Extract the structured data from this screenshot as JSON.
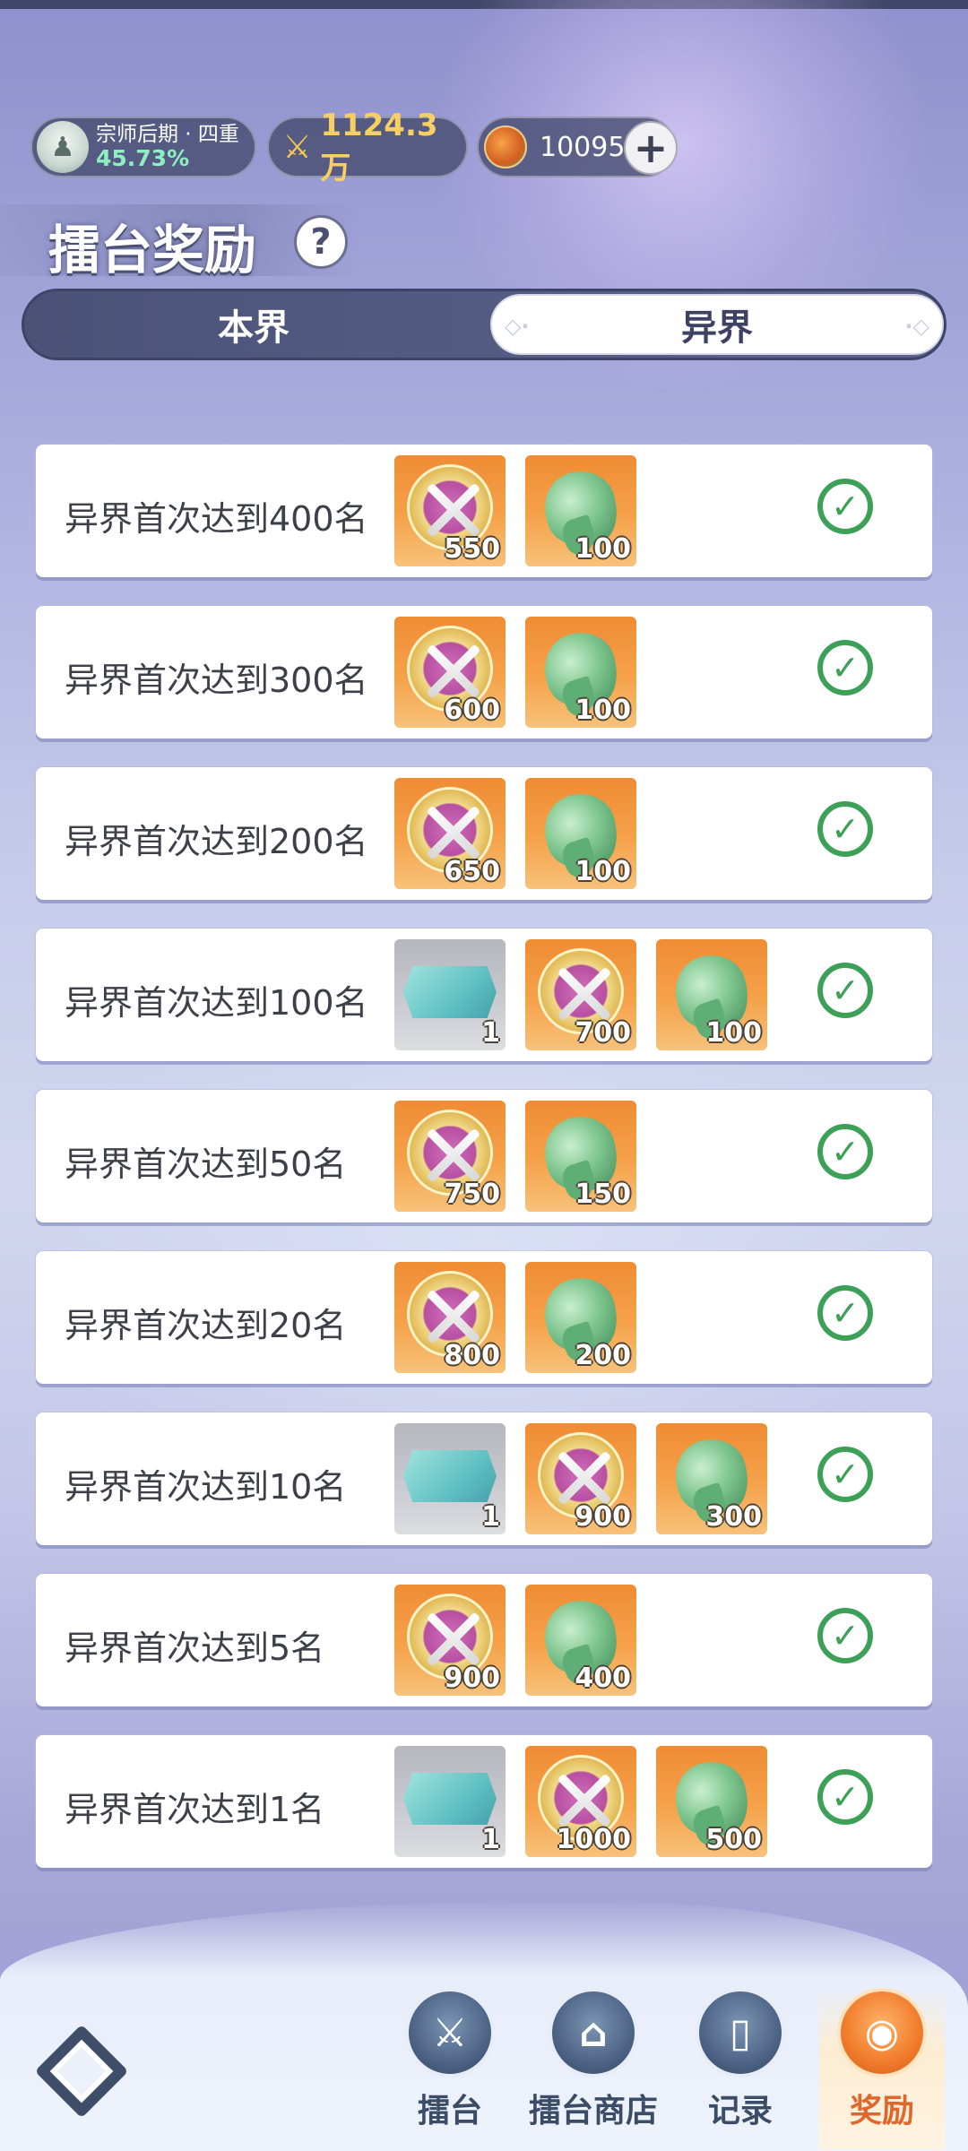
{
  "status": {
    "realm_name": "宗师后期 · 四重",
    "realm_progress": "45.73%",
    "power": "1124.3万",
    "currency": "10095"
  },
  "header": {
    "title": "擂台奖励",
    "help": "?"
  },
  "tabs": [
    {
      "label": "本界",
      "selected": false
    },
    {
      "label": "异界",
      "selected": true
    }
  ],
  "rows": [
    {
      "label": "异界首次达到400名",
      "rewards": [
        {
          "item": "medal-icon",
          "qty": "550"
        },
        {
          "item": "jade-icon",
          "qty": "100"
        }
      ],
      "claimed": true
    },
    {
      "label": "异界首次达到300名",
      "rewards": [
        {
          "item": "medal-icon",
          "qty": "600"
        },
        {
          "item": "jade-icon",
          "qty": "100"
        }
      ],
      "claimed": true
    },
    {
      "label": "异界首次达到200名",
      "rewards": [
        {
          "item": "medal-icon",
          "qty": "650"
        },
        {
          "item": "jade-icon",
          "qty": "100"
        }
      ],
      "claimed": true
    },
    {
      "label": "异界首次达到100名",
      "rewards": [
        {
          "item": "ticket-icon",
          "qty": "1"
        },
        {
          "item": "medal-icon",
          "qty": "700"
        },
        {
          "item": "jade-icon",
          "qty": "100"
        }
      ],
      "claimed": true
    },
    {
      "label": "异界首次达到50名",
      "rewards": [
        {
          "item": "medal-icon",
          "qty": "750"
        },
        {
          "item": "jade-icon",
          "qty": "150"
        }
      ],
      "claimed": true
    },
    {
      "label": "异界首次达到20名",
      "rewards": [
        {
          "item": "medal-icon",
          "qty": "800"
        },
        {
          "item": "jade-icon",
          "qty": "200"
        }
      ],
      "claimed": true
    },
    {
      "label": "异界首次达到10名",
      "rewards": [
        {
          "item": "ticket-icon",
          "qty": "1"
        },
        {
          "item": "medal-icon",
          "qty": "900"
        },
        {
          "item": "jade-icon",
          "qty": "300"
        }
      ],
      "claimed": true
    },
    {
      "label": "异界首次达到5名",
      "rewards": [
        {
          "item": "medal-icon",
          "qty": "900"
        },
        {
          "item": "jade-icon",
          "qty": "400"
        }
      ],
      "claimed": true
    },
    {
      "label": "异界首次达到1名",
      "rewards": [
        {
          "item": "ticket-icon",
          "qty": "1"
        },
        {
          "item": "medal-icon",
          "qty": "1000"
        },
        {
          "item": "jade-icon",
          "qty": "500"
        }
      ],
      "claimed": true
    }
  ],
  "bottom_nav": [
    {
      "label": "擂台",
      "icon": "arena-icon",
      "active": false
    },
    {
      "label": "擂台商店",
      "icon": "shop-icon",
      "active": false
    },
    {
      "label": "记录",
      "icon": "record-icon",
      "active": false
    },
    {
      "label": "奖励",
      "icon": "reward-icon",
      "active": true
    }
  ],
  "colors": {
    "check_green": "#3ca057",
    "active_orange": "#e0672c",
    "reward_orange": "#ef8c34"
  }
}
